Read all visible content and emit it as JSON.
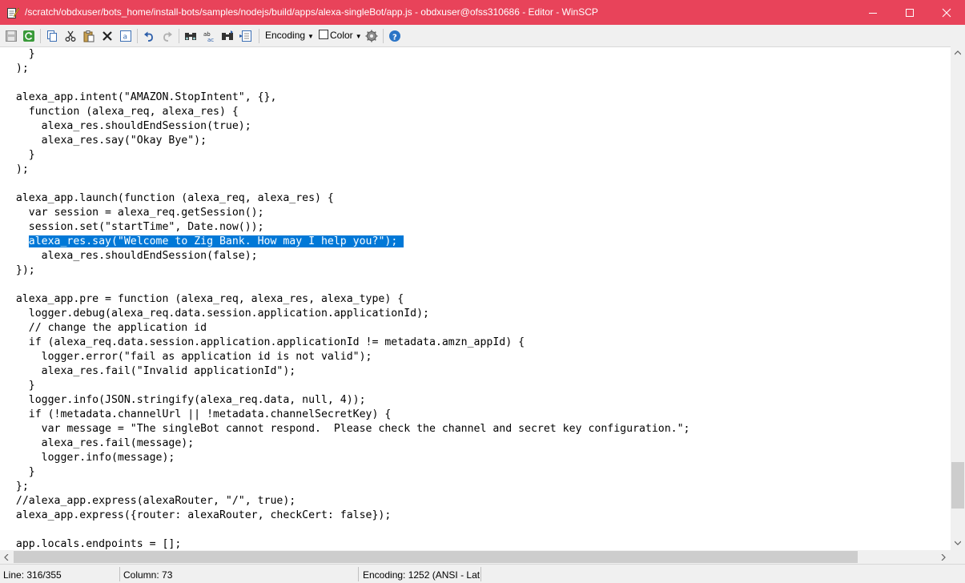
{
  "window": {
    "title": "/scratch/obdxuser/bots_home/install-bots/samples/nodejs/build/apps/alexa-singleBot/app.js - obdxuser@ofss310686 - Editor - WinSCP",
    "accent_color": "#e8435a"
  },
  "toolbar": {
    "icons": [
      "save-icon",
      "reload-icon",
      "copy-icon",
      "cut-icon",
      "paste-icon",
      "delete-icon",
      "select-all-icon",
      "undo-icon",
      "redo-icon",
      "find-icon",
      "replace-icon",
      "find-next-icon",
      "go-to-line-icon",
      "settings-icon",
      "help-icon"
    ],
    "encoding_label": "Encoding",
    "color_label": "Color"
  },
  "editor": {
    "selection_color": "#0078d7",
    "lines": [
      {
        "text": "    }"
      },
      {
        "text": "  );"
      },
      {
        "text": ""
      },
      {
        "text": "  alexa_app.intent(\"AMAZON.StopIntent\", {},"
      },
      {
        "text": "    function (alexa_req, alexa_res) {"
      },
      {
        "text": "      alexa_res.shouldEndSession(true);"
      },
      {
        "text": "      alexa_res.say(\"Okay Bye\");"
      },
      {
        "text": "    }"
      },
      {
        "text": "  );"
      },
      {
        "text": ""
      },
      {
        "text": "  alexa_app.launch(function (alexa_req, alexa_res) {"
      },
      {
        "text": "    var session = alexa_req.getSession();"
      },
      {
        "text": "    session.set(\"startTime\", Date.now());"
      },
      {
        "text": "    ",
        "selected": "alexa_res.say(\"Welcome to Zig Bank. How may I help you?\"); "
      },
      {
        "text": "      alexa_res.shouldEndSession(false);"
      },
      {
        "text": "  });"
      },
      {
        "text": ""
      },
      {
        "text": "  alexa_app.pre = function (alexa_req, alexa_res, alexa_type) {"
      },
      {
        "text": "    logger.debug(alexa_req.data.session.application.applicationId);"
      },
      {
        "text": "    // change the application id"
      },
      {
        "text": "    if (alexa_req.data.session.application.applicationId != metadata.amzn_appId) {"
      },
      {
        "text": "      logger.error(\"fail as application id is not valid\");"
      },
      {
        "text": "      alexa_res.fail(\"Invalid applicationId\");"
      },
      {
        "text": "    }"
      },
      {
        "text": "    logger.info(JSON.stringify(alexa_req.data, null, 4));"
      },
      {
        "text": "    if (!metadata.channelUrl || !metadata.channelSecretKey) {"
      },
      {
        "text": "      var message = \"The singleBot cannot respond.  Please check the channel and secret key configuration.\";"
      },
      {
        "text": "      alexa_res.fail(message);"
      },
      {
        "text": "      logger.info(message);"
      },
      {
        "text": "    }"
      },
      {
        "text": "  };"
      },
      {
        "text": "  //alexa_app.express(alexaRouter, \"/\", true);"
      },
      {
        "text": "  alexa_app.express({router: alexaRouter, checkCert: false});"
      },
      {
        "text": ""
      },
      {
        "text": "  app.locals.endpoints = [];"
      }
    ]
  },
  "statusbar": {
    "line": "Line: 316/355",
    "column": "Column: 73",
    "encoding": "Encoding: 1252  (ANSI - Lat"
  }
}
